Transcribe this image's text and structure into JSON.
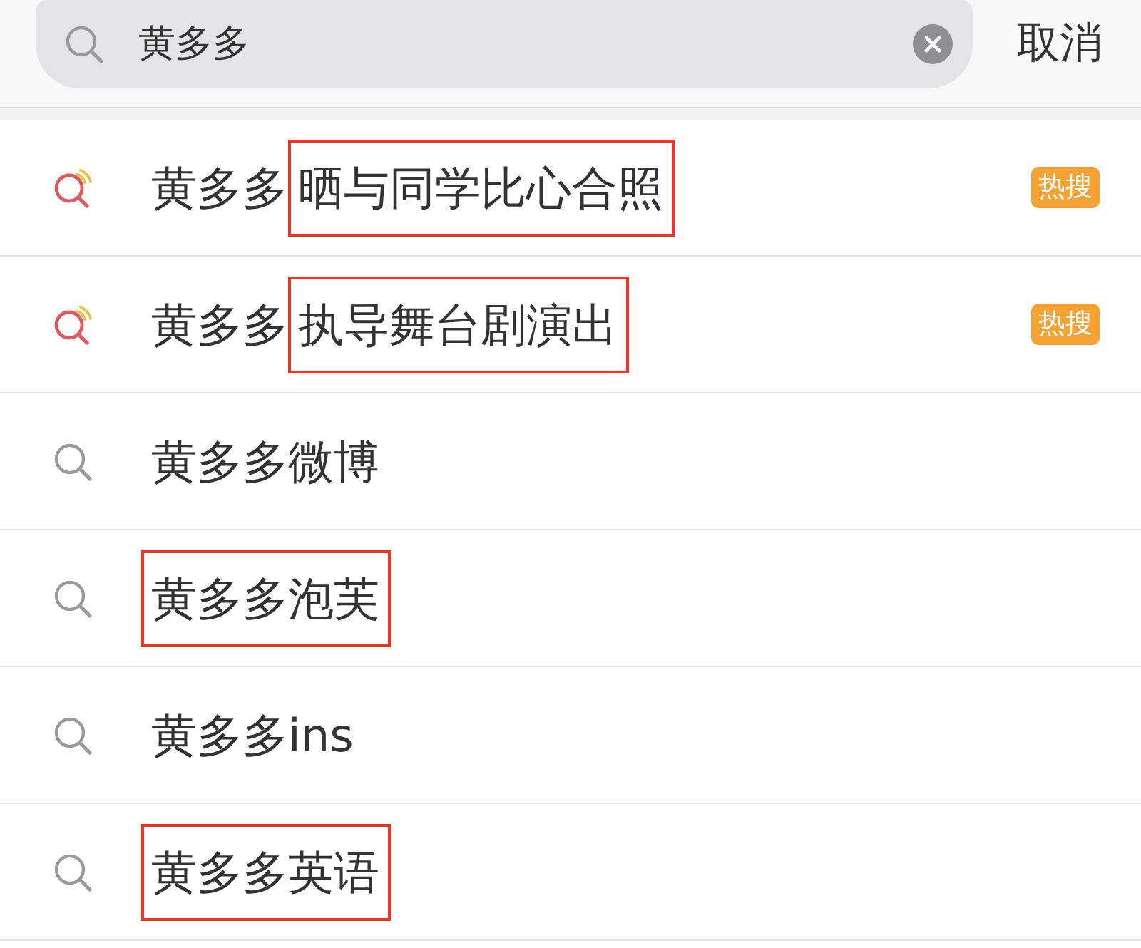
{
  "search_bar": {
    "value": "黄多多"
  },
  "cancel_label": "取消",
  "suggestions": [
    {
      "kind": "hot",
      "segments": [
        {
          "text": "黄多多",
          "boxed": false
        },
        {
          "text": "晒与同学比心合照",
          "boxed": true
        }
      ],
      "badge": "热搜"
    },
    {
      "kind": "hot",
      "segments": [
        {
          "text": "黄多多",
          "boxed": false
        },
        {
          "text": "执导舞台剧演出",
          "boxed": true
        }
      ],
      "badge": "热搜"
    },
    {
      "kind": "normal",
      "segments": [
        {
          "text": "黄多多微博",
          "boxed": false
        }
      ]
    },
    {
      "kind": "normal",
      "segments": [
        {
          "text": "黄多多泡芙",
          "boxed": true
        }
      ]
    },
    {
      "kind": "normal",
      "segments": [
        {
          "text": "黄多多ins",
          "boxed": false
        }
      ]
    },
    {
      "kind": "normal",
      "segments": [
        {
          "text": "黄多多英语",
          "boxed": true
        }
      ]
    }
  ]
}
